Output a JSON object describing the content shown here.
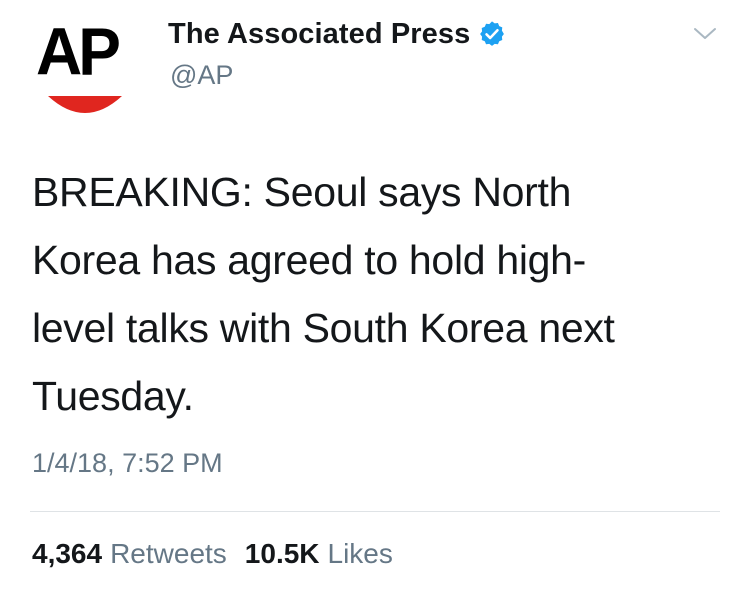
{
  "avatar": {
    "logo_text": "AP",
    "arc_color": "#e0261f"
  },
  "header": {
    "display_name": "The Associated Press",
    "handle": "@AP",
    "verified_badge_color": "#1da1f2"
  },
  "tweet": {
    "text_lines": [
      "BREAKING: Seoul says North",
      "Korea has agreed to hold high-",
      "level talks with South Korea next",
      "Tuesday."
    ],
    "timestamp": "1/4/18, 7:52 PM"
  },
  "stats": {
    "retweets_count": "4,364",
    "retweets_label": "Retweets",
    "likes_count": "10.5K",
    "likes_label": "Likes"
  },
  "icons": {
    "verified": "verified-badge-icon",
    "menu": "chevron-down-icon"
  },
  "colors": {
    "primary_text": "#14171a",
    "secondary_text": "#657786",
    "divider": "#dfe3e6"
  }
}
